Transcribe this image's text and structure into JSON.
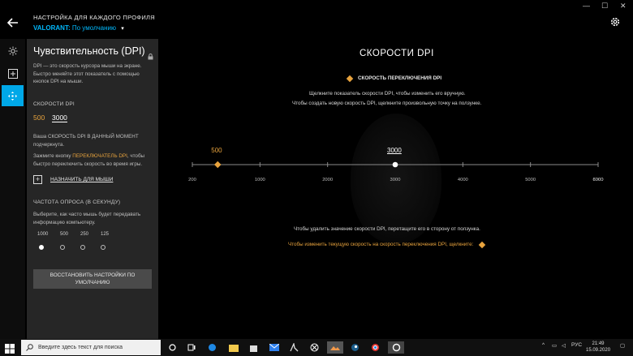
{
  "header": {
    "title": "НАСТРОЙКА ДЛЯ КАЖДОГО ПРОФИЛЯ",
    "game": "VALORANT:",
    "profile": "По умолчанию",
    "min": "—",
    "max": "☐",
    "close": "✕"
  },
  "panel": {
    "title": "Чувствительность (DPI)",
    "description": "DPI — это скорость курсора мыши на экране. Быстро меняйте этот показатель с помощью кнопок DPI на мыши.",
    "dpi_label": "СКОРОСТИ DPI",
    "dpi_levels": [
      "500",
      "3000"
    ],
    "current_note": "Ваша СКОРОСТЬ DPI В ДАННЫЙ МОМЕНТ подчеркнута.",
    "shift_hint_pre": "Зажмите кнопку ",
    "shift_hint_link": "ПЕРЕКЛЮЧАТЕЛЬ DPI",
    "shift_hint_post": ", чтобы быстро переключить скорость во время игры.",
    "assign_label": "НАЗНАЧИТЬ ДЛЯ МЫШИ",
    "rate_label": "ЧАСТОТА ОПРОСА (В СЕКУНДУ)",
    "rate_desc": "Выберите, как часто мышь будет передавать информацию компьютеру.",
    "rates": [
      "1000",
      "500",
      "250",
      "125"
    ],
    "selected_rate": "1000",
    "reset_line1": "ВОССТАНОВИТЬ НАСТРОЙКИ ПО",
    "reset_line2": "УМОЛЧАНИЮ"
  },
  "main": {
    "title": "СКОРОСТИ DPI",
    "shift_label": "СКОРОСТЬ ПЕРЕКЛЮЧЕНИЯ DPI",
    "hint1": "Щелкните показатель скорости DPI, чтобы изменить его вручную.",
    "hint2": "Чтобы создать новую скорость DPI, щелкните произвольную точку на ползунке.",
    "hint3": "Чтобы удалить значение скорости DPI, перетащите его в сторону от ползунка.",
    "hint4": "Чтобы изменить текущую скорость на скорость переключения DPI, щелкните:",
    "slider": {
      "min": 200,
      "max": 8000,
      "ticks": [
        "200",
        "1000",
        "2000",
        "3000",
        "4000",
        "5000",
        "6000",
        "8000"
      ],
      "shift_value": "500",
      "current_value": "3000"
    }
  },
  "taskbar": {
    "search_placeholder": "Введите здесь текст для поиска",
    "lang": "РУС",
    "time": "21:49",
    "date": "15.09.2020"
  },
  "colors": {
    "accent_blue": "#00a8e8",
    "accent_orange": "#e8a33d",
    "panel_bg": "#262626"
  }
}
